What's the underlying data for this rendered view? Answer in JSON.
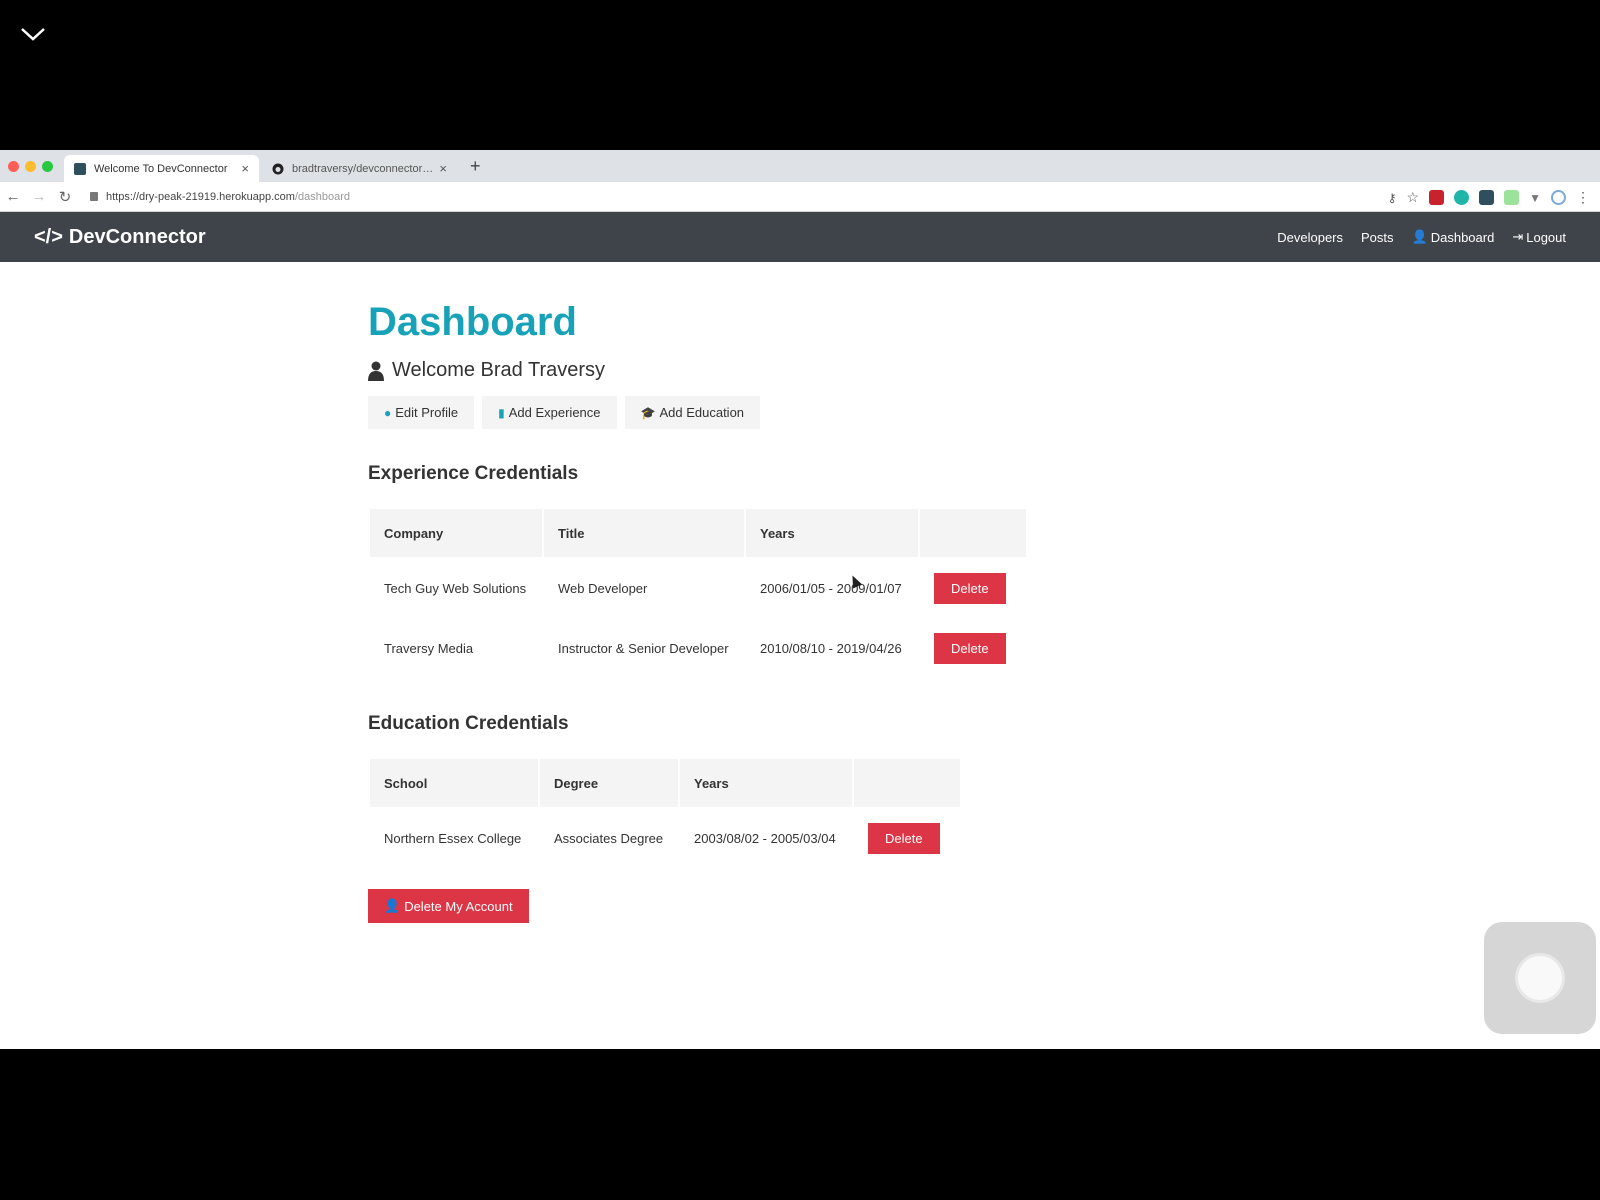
{
  "browser": {
    "tabs": [
      {
        "title": "Welcome To DevConnector",
        "active": true
      },
      {
        "title": "bradtraversy/devconnector_2...",
        "active": false
      }
    ],
    "url": {
      "host": "https://dry-peak-21919.herokuapp.com",
      "path": "/dashboard"
    }
  },
  "navbar": {
    "brand": "DevConnector",
    "links": {
      "developers": "Developers",
      "posts": "Posts",
      "dashboard": "Dashboard",
      "logout": "Logout"
    }
  },
  "page": {
    "title": "Dashboard",
    "welcome": "Welcome Brad Traversy",
    "actions": {
      "edit_profile": "Edit Profile",
      "add_experience": "Add Experience",
      "add_education": "Add Education"
    }
  },
  "experience": {
    "heading": "Experience Credentials",
    "columns": [
      "Company",
      "Title",
      "Years",
      ""
    ],
    "rows": [
      {
        "company": "Tech Guy Web Solutions",
        "title": "Web Developer",
        "years": "2006/01/05 - 2009/01/07",
        "action": "Delete"
      },
      {
        "company": "Traversy Media",
        "title": "Instructor & Senior Developer",
        "years": "2010/08/10 - 2019/04/26",
        "action": "Delete"
      }
    ]
  },
  "education": {
    "heading": "Education Credentials",
    "columns": [
      "School",
      "Degree",
      "Years",
      ""
    ],
    "rows": [
      {
        "school": "Northern Essex College",
        "degree": "Associates Degree",
        "years": "2003/08/02 - 2005/03/04",
        "action": "Delete"
      }
    ]
  },
  "delete_account_label": "Delete My Account",
  "colors": {
    "primary": "#17a2b8",
    "danger": "#dc3545",
    "dark": "#343a40",
    "light": "#f4f4f4"
  }
}
